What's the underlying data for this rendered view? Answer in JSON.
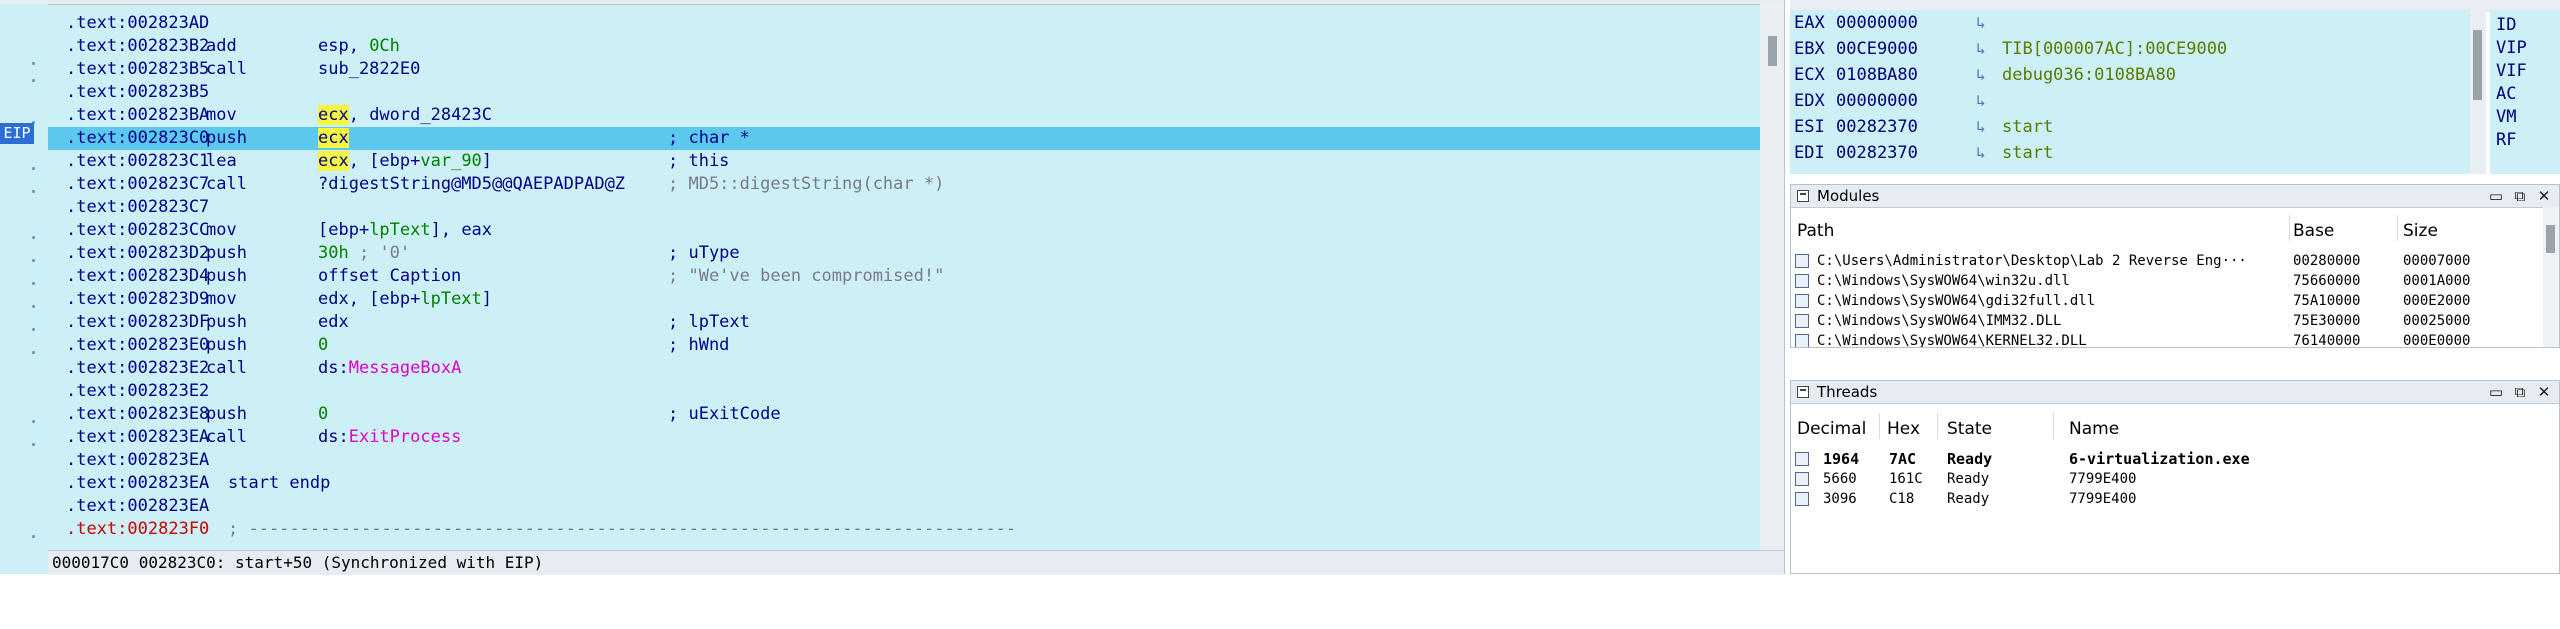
{
  "disassembly": {
    "lines": [
      {
        "addr": ".text:002823AD",
        "mnem": "",
        "operands": "",
        "comment": ""
      },
      {
        "addr": ".text:002823B2",
        "mnem": "add",
        "operands": "esp, 0Ch",
        "comment": ""
      },
      {
        "addr": ".text:002823B5",
        "mnem": "call",
        "operands": "sub_2822E0",
        "comment": ""
      },
      {
        "addr": ".text:002823B5",
        "mnem": "",
        "operands": "",
        "comment": ""
      },
      {
        "addr": ".text:002823BA",
        "mnem": "mov",
        "operands": "ecx, dword_28423C",
        "comment": ""
      },
      {
        "addr": ".text:002823C0",
        "mnem": "push",
        "operands": "ecx",
        "comment": "; char *"
      },
      {
        "addr": ".text:002823C1",
        "mnem": "lea",
        "operands": "ecx, [ebp+var_90]",
        "comment": "; this"
      },
      {
        "addr": ".text:002823C7",
        "mnem": "call",
        "operands": "?digestString@MD5@@QAEPADPAD@Z",
        "comment": "; MD5::digestString(char *)"
      },
      {
        "addr": ".text:002823C7",
        "mnem": "",
        "operands": "",
        "comment": ""
      },
      {
        "addr": ".text:002823CC",
        "mnem": "mov",
        "operands": "[ebp+lpText], eax",
        "comment": ""
      },
      {
        "addr": ".text:002823D2",
        "mnem": "push",
        "operands": "30h ; '0'",
        "comment": "; uType"
      },
      {
        "addr": ".text:002823D4",
        "mnem": "push",
        "operands": "offset Caption",
        "comment": "; \"We've been compromised!\""
      },
      {
        "addr": ".text:002823D9",
        "mnem": "mov",
        "operands": "edx, [ebp+lpText]",
        "comment": ""
      },
      {
        "addr": ".text:002823DF",
        "mnem": "push",
        "operands": "edx",
        "comment": "; lpText"
      },
      {
        "addr": ".text:002823E0",
        "mnem": "push",
        "operands": "0",
        "comment": "; hWnd"
      },
      {
        "addr": ".text:002823E2",
        "mnem": "call",
        "operands": "ds:MessageBoxA",
        "comment": ""
      },
      {
        "addr": ".text:002823E2",
        "mnem": "",
        "operands": "",
        "comment": ""
      },
      {
        "addr": ".text:002823E8",
        "mnem": "push",
        "operands": "0",
        "comment": "; uExitCode"
      },
      {
        "addr": ".text:002823EA",
        "mnem": "call",
        "operands": "ds:ExitProcess",
        "comment": ""
      },
      {
        "addr": ".text:002823EA",
        "mnem": "",
        "operands": "",
        "comment": ""
      },
      {
        "addr": ".text:002823EA",
        "mnem": "start endp",
        "operands": "",
        "comment": ""
      },
      {
        "addr": ".text:002823EA",
        "mnem": "",
        "operands": "",
        "comment": ""
      },
      {
        "addr": ".text:002823F0",
        "mnem": "; ---------------------------------------------------------------------------",
        "operands": "",
        "comment": ""
      }
    ],
    "eip_label": "EIP",
    "status": "000017C0 002823C0: start+50 (Synchronized with EIP)"
  },
  "registers": [
    {
      "name": "EAX",
      "value": "00000000",
      "arrow": "↳",
      "comment": ""
    },
    {
      "name": "EBX",
      "value": "00CE9000",
      "arrow": "↳",
      "comment": "TIB[000007AC]:00CE9000"
    },
    {
      "name": "ECX",
      "value": "0108BA80",
      "arrow": "↳",
      "comment": "debug036:0108BA80"
    },
    {
      "name": "EDX",
      "value": "00000000",
      "arrow": "↳",
      "comment": ""
    },
    {
      "name": "ESI",
      "value": "00282370",
      "arrow": "↳",
      "comment": "start"
    },
    {
      "name": "EDI",
      "value": "00282370",
      "arrow": "↳",
      "comment": "start"
    }
  ],
  "flags": [
    "ID",
    "VIP",
    "VIF",
    "AC",
    "VM",
    "RF"
  ],
  "modules": {
    "title": "Modules",
    "columns": [
      "Path",
      "Base",
      "Size"
    ],
    "rows": [
      {
        "path": "C:\\Users\\Administrator\\Desktop\\Lab 2 Reverse Eng···",
        "base": "00280000",
        "size": "00007000"
      },
      {
        "path": "C:\\Windows\\SysWOW64\\win32u.dll",
        "base": "75660000",
        "size": "0001A000"
      },
      {
        "path": "C:\\Windows\\SysWOW64\\gdi32full.dll",
        "base": "75A10000",
        "size": "000E2000"
      },
      {
        "path": "C:\\Windows\\SysWOW64\\IMM32.DLL",
        "base": "75E30000",
        "size": "00025000"
      },
      {
        "path": "C:\\Windows\\SysWOW64\\KERNEL32.DLL",
        "base": "76140000",
        "size": "000E0000"
      }
    ]
  },
  "threads": {
    "title": "Threads",
    "columns": [
      "Decimal",
      "Hex",
      "State",
      "Name"
    ],
    "rows": [
      {
        "decimal": "1964",
        "hex": "7AC",
        "state": "Ready",
        "name": "6-virtualization.exe"
      },
      {
        "decimal": "5660",
        "hex": "161C",
        "state": "Ready",
        "name": "7799E400"
      },
      {
        "decimal": "3096",
        "hex": "C18",
        "state": "Ready",
        "name": "7799E400"
      }
    ]
  },
  "window_buttons": {
    "minimize": "▭",
    "restore": "⧉",
    "close": "✕"
  }
}
